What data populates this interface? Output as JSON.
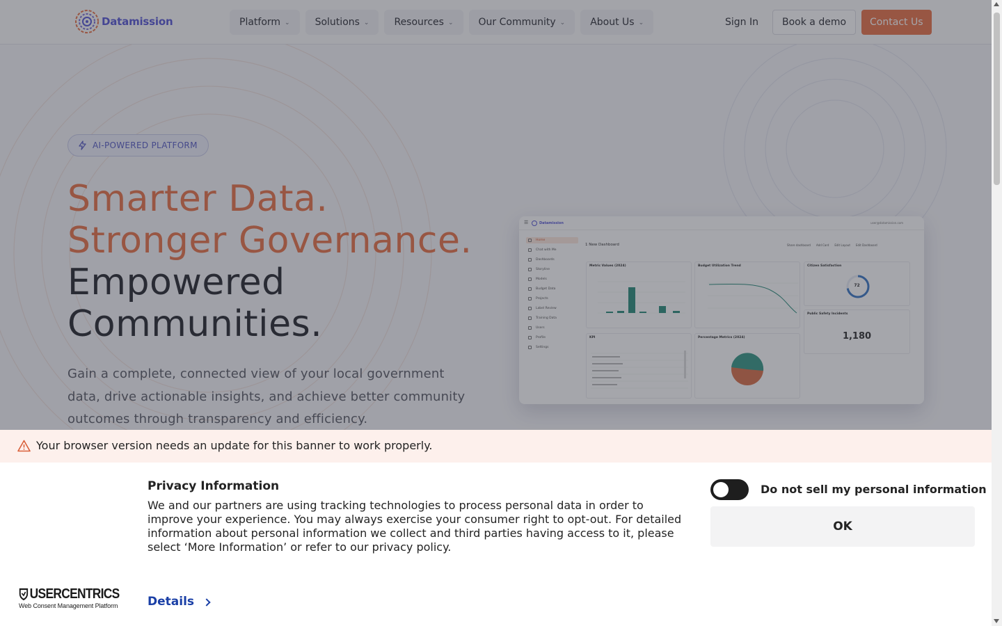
{
  "nav": {
    "logo_text": "Datamission",
    "menu": [
      {
        "label": "Platform"
      },
      {
        "label": "Solutions"
      },
      {
        "label": "Resources"
      },
      {
        "label": "Our Community"
      },
      {
        "label": "About Us"
      }
    ],
    "sign_in": "Sign In",
    "book_demo": "Book a demo",
    "contact": "Contact Us"
  },
  "hero": {
    "pill": "AI-POWERED PLATFORM",
    "title_line1": "Smarter Data.",
    "title_line2": "Stronger Governance.",
    "title_line3": "Empowered",
    "title_line4": "Communities.",
    "subtitle": "Gain a complete, connected view of your local government data, drive actionable insights, and achieve better community outcomes through transparency and efficiency."
  },
  "dashboard": {
    "logo": "Datamission",
    "user": "user@datamission.com",
    "heading": "1 New Dashboard",
    "actions": [
      "Share dashboard",
      "Add Card",
      "Edit Layout",
      "Edit Dashboard"
    ],
    "sidebar": [
      "Home",
      "Chat with Me",
      "Dashboards",
      "Storyline",
      "Models",
      "Budget Data",
      "Projects",
      "Label Review",
      "Training Data",
      "Users",
      "Profile",
      "Settings"
    ],
    "cards": {
      "metric_values": "Metric Values (2024)",
      "budget_trend": "Budget Utilization Trend",
      "citizen_satisfaction": "Citizen Satisfaction",
      "gauge_value": "72",
      "public_safety": "Public Safety Incidents",
      "public_safety_value": "1,180",
      "kpi": "KPI",
      "percentage_metrics": "Percentage Metrics (2024)"
    }
  },
  "banner": {
    "warning": "Your browser version needs an update for this banner to work properly.",
    "title": "Privacy Information",
    "body": "We and our partners are using tracking technologies to process personal data in order to improve your experience. You may always exercise your consumer right to opt-out. For detailed information about personal information we collect and third parties having access to it, please select ‘More Information’ or refer to our privacy policy.",
    "toggle_label": "Do not sell my personal information",
    "toggle_on": false,
    "ok": "OK",
    "details": "Details",
    "brand_main": "USERCENTRICS",
    "brand_sub": "Web Consent Management Platform"
  },
  "colors": {
    "accent_orange": "#e8754c",
    "brand_purple": "#5b5bd6",
    "link_blue": "#1a3fa6"
  }
}
